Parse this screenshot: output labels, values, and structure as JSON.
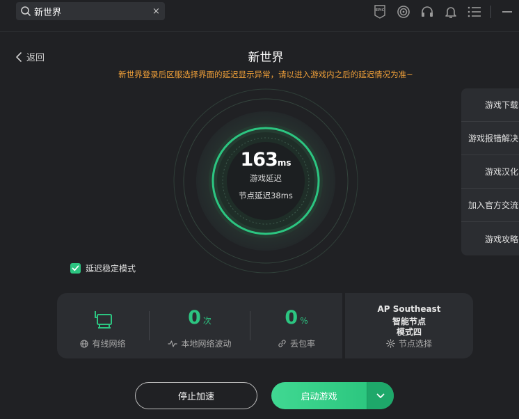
{
  "search": {
    "value": "新世界",
    "clear_label": "×"
  },
  "header": {
    "back_label": "返回",
    "title": "新世界",
    "warning": "新世界登录后区服选择界面的延迟显示异常，请以进入游戏内之后的延迟情况为准~"
  },
  "gauge": {
    "latency_value": "163",
    "latency_unit": "ms",
    "latency_label": "游戏延迟",
    "node_latency": "节点延迟38ms"
  },
  "side_panel": {
    "items": [
      "游戏下载",
      "游戏报错解决",
      "游戏汉化",
      "加入官方交流",
      "游戏攻略"
    ]
  },
  "stable_mode": {
    "label": "延迟稳定模式",
    "checked": true
  },
  "stats": {
    "network_label": "有线网络",
    "fluctuation_value": "0",
    "fluctuation_unit": "次",
    "fluctuation_label": "本地网络波动",
    "loss_value": "0",
    "loss_unit": "%",
    "loss_label": "丢包率"
  },
  "node": {
    "region": "AP Southeast",
    "type": "智能节点",
    "mode": "模式四",
    "select_label": "节点选择"
  },
  "buttons": {
    "stop_label": "停止加速",
    "start_label": "启动游戏"
  },
  "colors": {
    "accent": "#2cc581",
    "warning": "#f0a039",
    "background": "#202124",
    "panel": "#2b2d31"
  },
  "icons": [
    "search-icon",
    "epic-games-icon",
    "ubisoft-icon",
    "headset-icon",
    "bell-icon",
    "menu-icon",
    "minimize-icon",
    "back-chevron-icon",
    "wired-network-icon",
    "globe-icon",
    "pulse-icon",
    "link-icon",
    "gear-icon",
    "check-icon",
    "chevron-down-icon"
  ]
}
